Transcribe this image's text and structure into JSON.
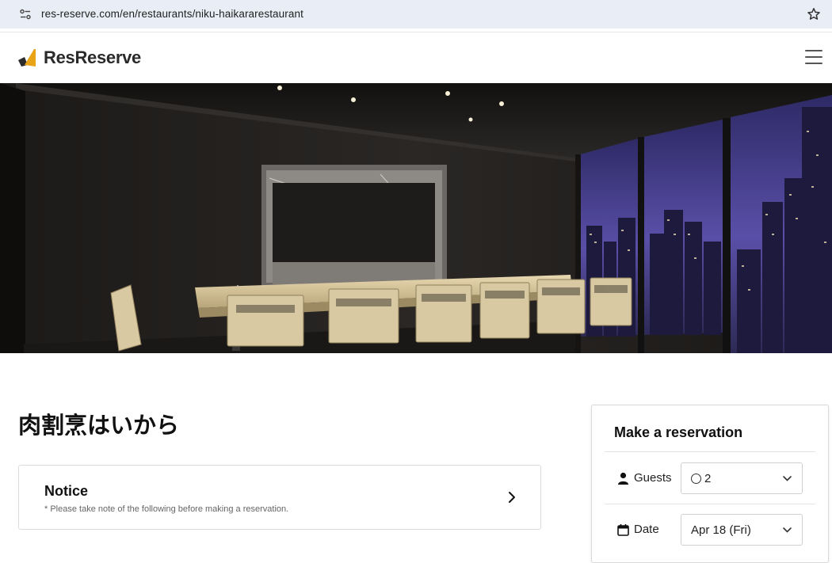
{
  "browser": {
    "url": "res-reserve.com/en/restaurants/niku-haikararestaurant"
  },
  "header": {
    "brand": "ResReserve",
    "logo_color": "#E8A317",
    "menu_icon": "hamburger-icon"
  },
  "hero": {
    "image_alt": "Restaurant private dining room with counter, chairs and night city view"
  },
  "restaurant": {
    "name": "肉割烹はいから"
  },
  "notice": {
    "title": "Notice",
    "subtitle": "* Please take note of the following before making a reservation."
  },
  "reservation": {
    "title": "Make a reservation",
    "guests_label": "Guests",
    "guests_value": "2",
    "date_label": "Date",
    "date_value": "Apr 18 (Fri)"
  }
}
